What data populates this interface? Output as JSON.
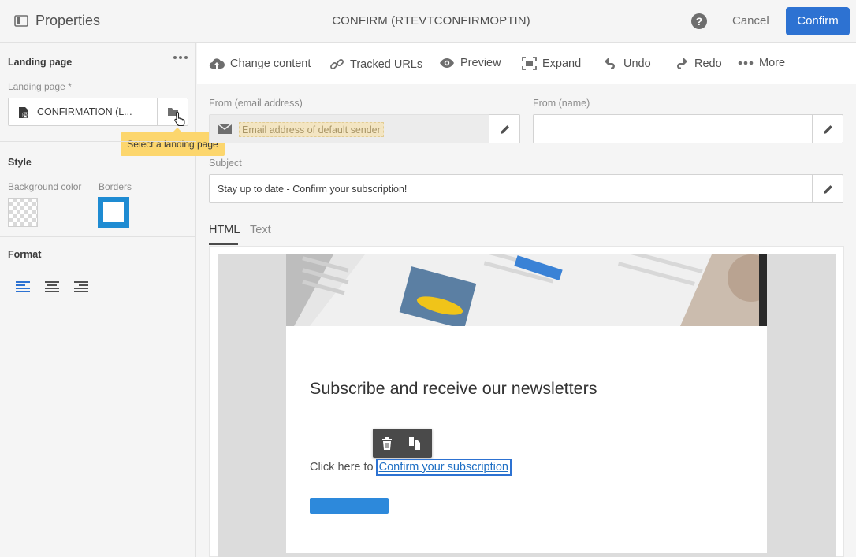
{
  "header": {
    "properties_label": "Properties",
    "title": "CONFIRM (RTEVTCONFIRMOPTIN)",
    "help_icon_text": "?",
    "cancel_label": "Cancel",
    "confirm_label": "Confirm"
  },
  "left_panel": {
    "landing_section": "Landing page",
    "landing_field_label": "Landing page *",
    "landing_field_value": "CONFIRMATION (L...",
    "tooltip": "Select a landing page",
    "style_section": "Style",
    "bg_color_label": "Background color",
    "borders_label": "Borders",
    "format_section": "Format"
  },
  "toolbar": {
    "items": [
      {
        "label": "Change content",
        "icon": "cloud-upload-icon"
      },
      {
        "label": "Tracked URLs",
        "icon": "link-icon"
      },
      {
        "label": "Preview",
        "icon": "eye-icon"
      },
      {
        "label": "Expand",
        "icon": "expand-icon"
      },
      {
        "label": "Undo",
        "icon": "undo-icon"
      },
      {
        "label": "Redo",
        "icon": "redo-icon"
      },
      {
        "label": "More",
        "icon": "more-icon"
      }
    ]
  },
  "form": {
    "from_email_label": "From (email address)",
    "from_email_placeholder": "Email address of default sender",
    "from_name_label": "From (name)",
    "from_name_value": "",
    "subject_label": "Subject",
    "subject_value": "Stay up to date - Confirm your subscription!"
  },
  "tabs": [
    "HTML",
    "Text"
  ],
  "email_preview": {
    "headline": "Subscribe and receive our newsletters",
    "click_prefix": "Click here to",
    "link_text": "Confirm your subscription"
  },
  "colors": {
    "accent": "#2d72d2",
    "border_swatch": "#1e8bd2",
    "tooltip": "#fcd66d",
    "link": "#1e6fc4"
  }
}
